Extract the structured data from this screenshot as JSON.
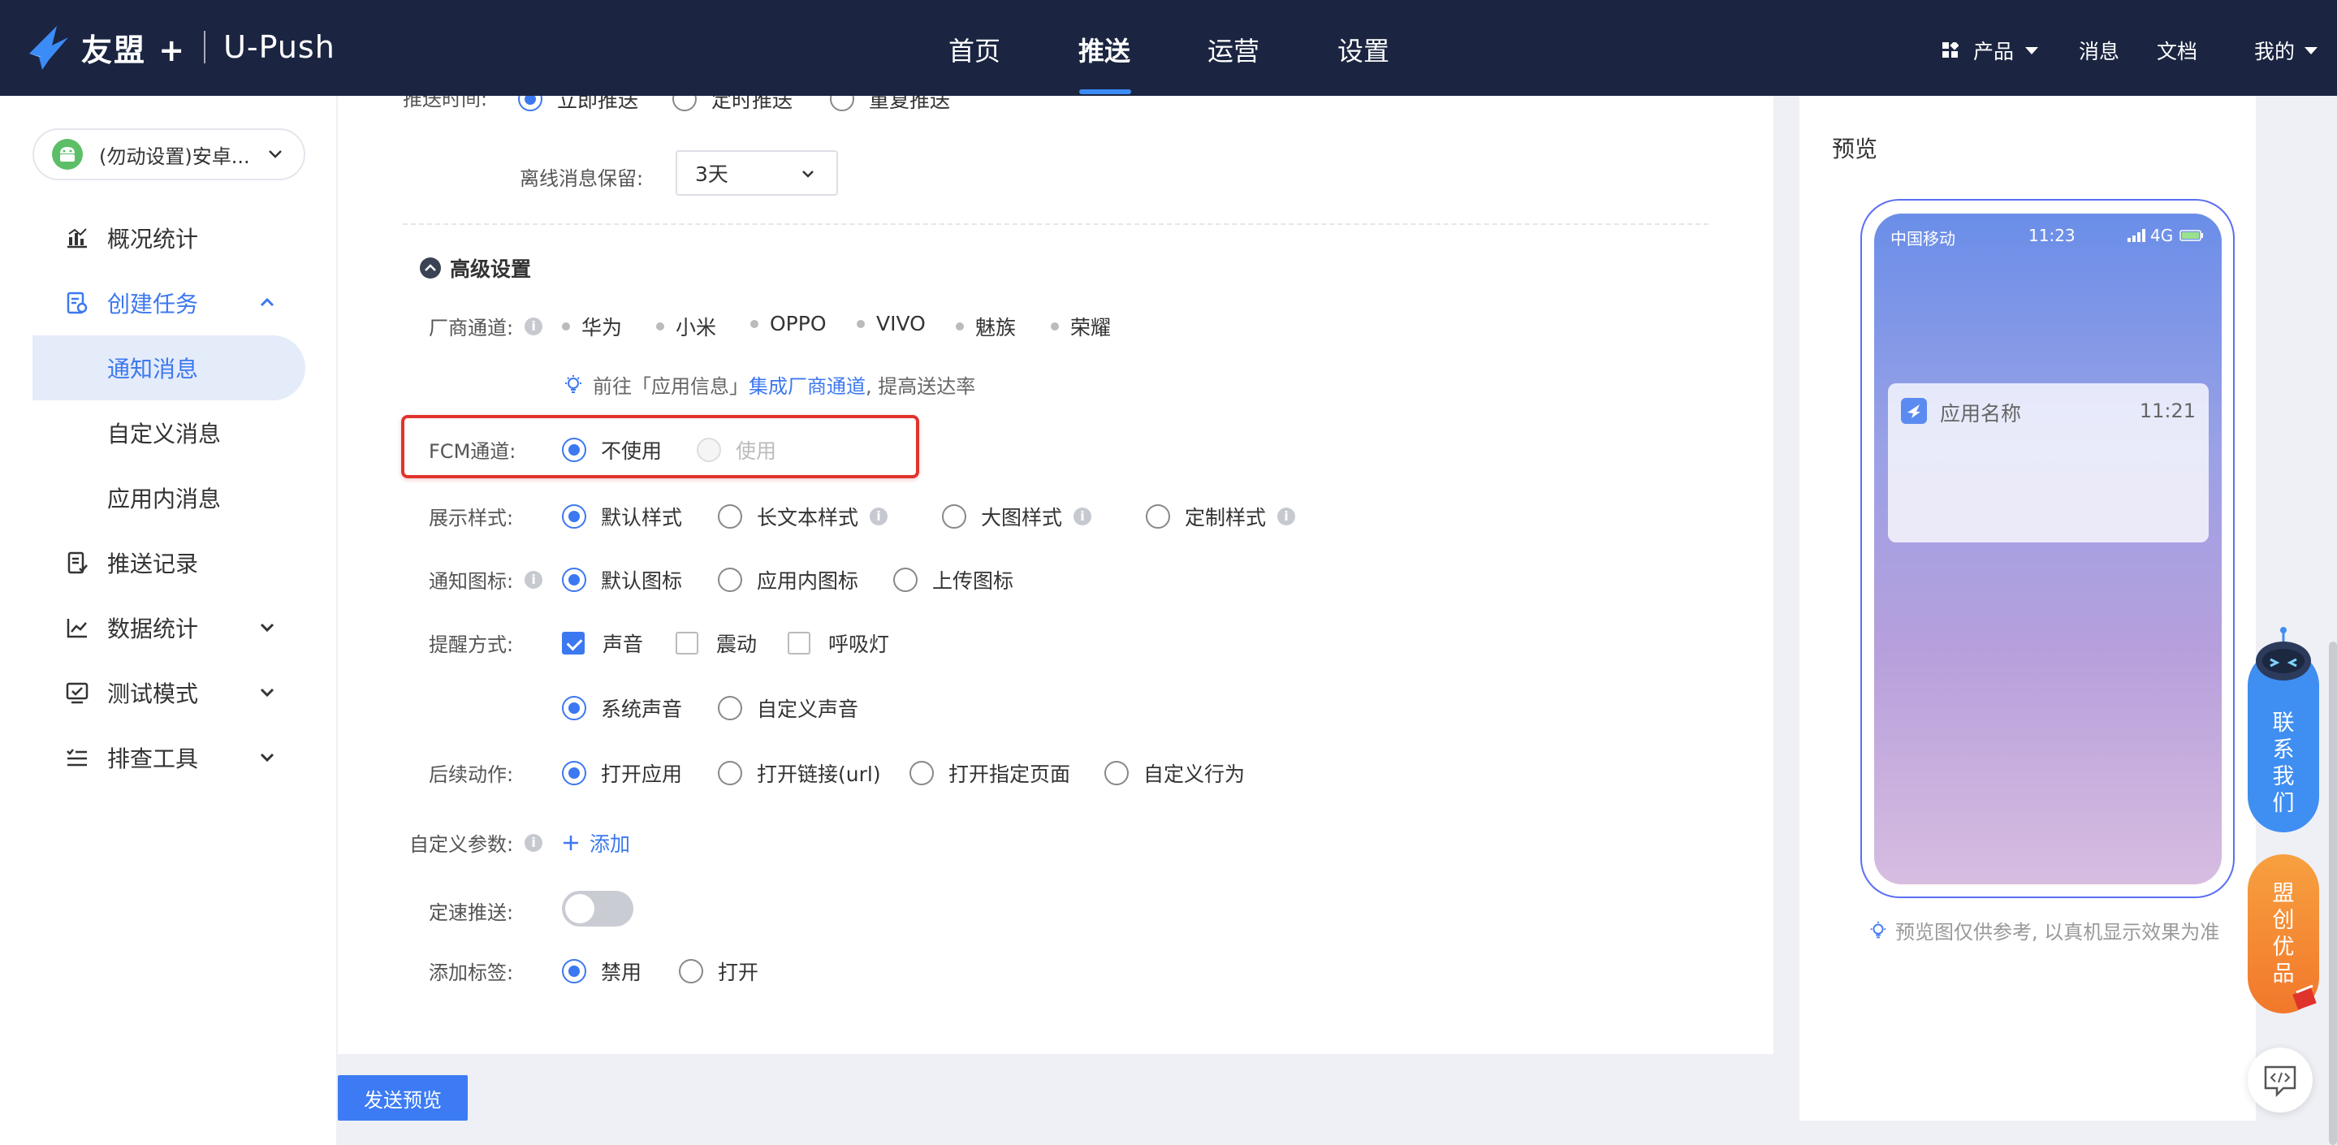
{
  "header": {
    "brand": "友盟 +",
    "product": "U-Push",
    "nav": [
      "首页",
      "推送",
      "运营",
      "设置"
    ],
    "active_nav": "推送",
    "right": {
      "products": "产品",
      "messages": "消息",
      "docs": "文档",
      "mine": "我的"
    }
  },
  "sidebar": {
    "app_selector": "(勿动设置)安卓...",
    "items": [
      {
        "label": "概况统计"
      },
      {
        "label": "创建任务"
      },
      {
        "label": "通知消息"
      },
      {
        "label": "自定义消息"
      },
      {
        "label": "应用内消息"
      },
      {
        "label": "推送记录"
      },
      {
        "label": "数据统计"
      },
      {
        "label": "测试模式"
      },
      {
        "label": "排查工具"
      }
    ]
  },
  "form": {
    "push_time": {
      "label": "推送时间:",
      "options": [
        "立即推送",
        "定时推送",
        "重复推送"
      ]
    },
    "offline": {
      "label": "离线消息保留:",
      "value": "3天"
    },
    "advanced": "高级设置",
    "vendor": {
      "label": "厂商通道:",
      "options": [
        "华为",
        "小米",
        "OPPO",
        "VIVO",
        "魅族",
        "荣耀"
      ]
    },
    "vendor_tip": {
      "prefix": "前往「应用信息」",
      "link": "集成厂商通道",
      "suffix": ", 提高送达率"
    },
    "fcm": {
      "label": "FCM通道:",
      "options": [
        "不使用",
        "使用"
      ]
    },
    "display": {
      "label": "展示样式:",
      "options": [
        "默认样式",
        "长文本样式",
        "大图样式",
        "定制样式"
      ]
    },
    "icon": {
      "label": "通知图标:",
      "options": [
        "默认图标",
        "应用内图标",
        "上传图标"
      ]
    },
    "remind": {
      "label": "提醒方式:",
      "options": [
        "声音",
        "震动",
        "呼吸灯"
      ]
    },
    "sound": {
      "options": [
        "系统声音",
        "自定义声音"
      ]
    },
    "after": {
      "label": "后续动作:",
      "options": [
        "打开应用",
        "打开链接(url)",
        "打开指定页面",
        "自定义行为"
      ]
    },
    "custom_params": {
      "label": "自定义参数:",
      "add": "添加"
    },
    "fixed_speed": {
      "label": "定速推送:"
    },
    "tags": {
      "label": "添加标签:",
      "options": [
        "禁用",
        "打开"
      ]
    },
    "send_preview": "发送预览"
  },
  "preview": {
    "title": "预览",
    "carrier": "中国移动",
    "time": "11:23",
    "network": "4G",
    "notif_app": "应用名称",
    "notif_time": "11:21",
    "note": "预览图仅供参考, 以真机显示效果为准"
  },
  "floating": {
    "contact": "联系我们",
    "promo": "盟创优品"
  },
  "colors": {
    "nav_bg": "#1b2541",
    "accent": "#3c78f0",
    "highlight_box": "#e0332c"
  }
}
